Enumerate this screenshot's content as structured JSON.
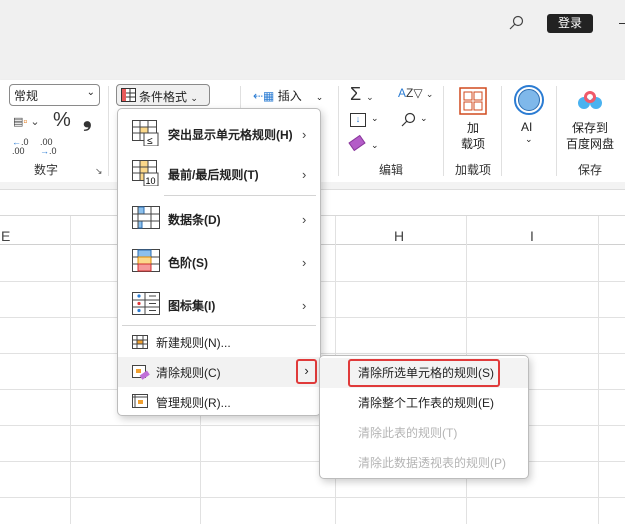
{
  "titlebar": {
    "login_label": "登录",
    "icons": [
      "search-icon",
      "minimize-icon"
    ]
  },
  "ribbon": {
    "number_format": "常规",
    "number_group_label": "数字",
    "percent_symbol": "%",
    "comma_symbol": "❟",
    "cond_format_label": "条件格式",
    "insert_label": "插入",
    "edit_group_label": "编辑",
    "addins_button_line1": "加",
    "addins_button_line2": "载项",
    "addins_group_label": "加载项",
    "ai_label": "AI",
    "save_button_line1": "保存到",
    "save_button_line2": "百度网盘",
    "save_group_label": "保存"
  },
  "columns": [
    "E",
    "H",
    "I"
  ],
  "menu": {
    "items": [
      {
        "label": "突出显示单元格规则(H)",
        "key": "H"
      },
      {
        "label": "最前/最后规则(T)",
        "key": "T"
      },
      {
        "label": "数据条(D)",
        "key": "D"
      },
      {
        "label": "色阶(S)",
        "key": "S"
      },
      {
        "label": "图标集(I)",
        "key": "I"
      },
      {
        "label": "新建规则(N)..."
      },
      {
        "label": "清除规则(C)"
      },
      {
        "label": "管理规则(R)..."
      }
    ]
  },
  "submenu": {
    "items": [
      {
        "label": "清除所选单元格的规则(S)",
        "enabled": true
      },
      {
        "label": "清除整个工作表的规则(E)",
        "enabled": true
      },
      {
        "label": "清除此表的规则(T)",
        "enabled": false
      },
      {
        "label": "清除此数据透视表的规则(P)",
        "enabled": false
      }
    ]
  },
  "colors": {
    "highlight": "#e03a3a",
    "accent_blue": "#2b7cd3",
    "addins_red": "#d04a1e"
  }
}
